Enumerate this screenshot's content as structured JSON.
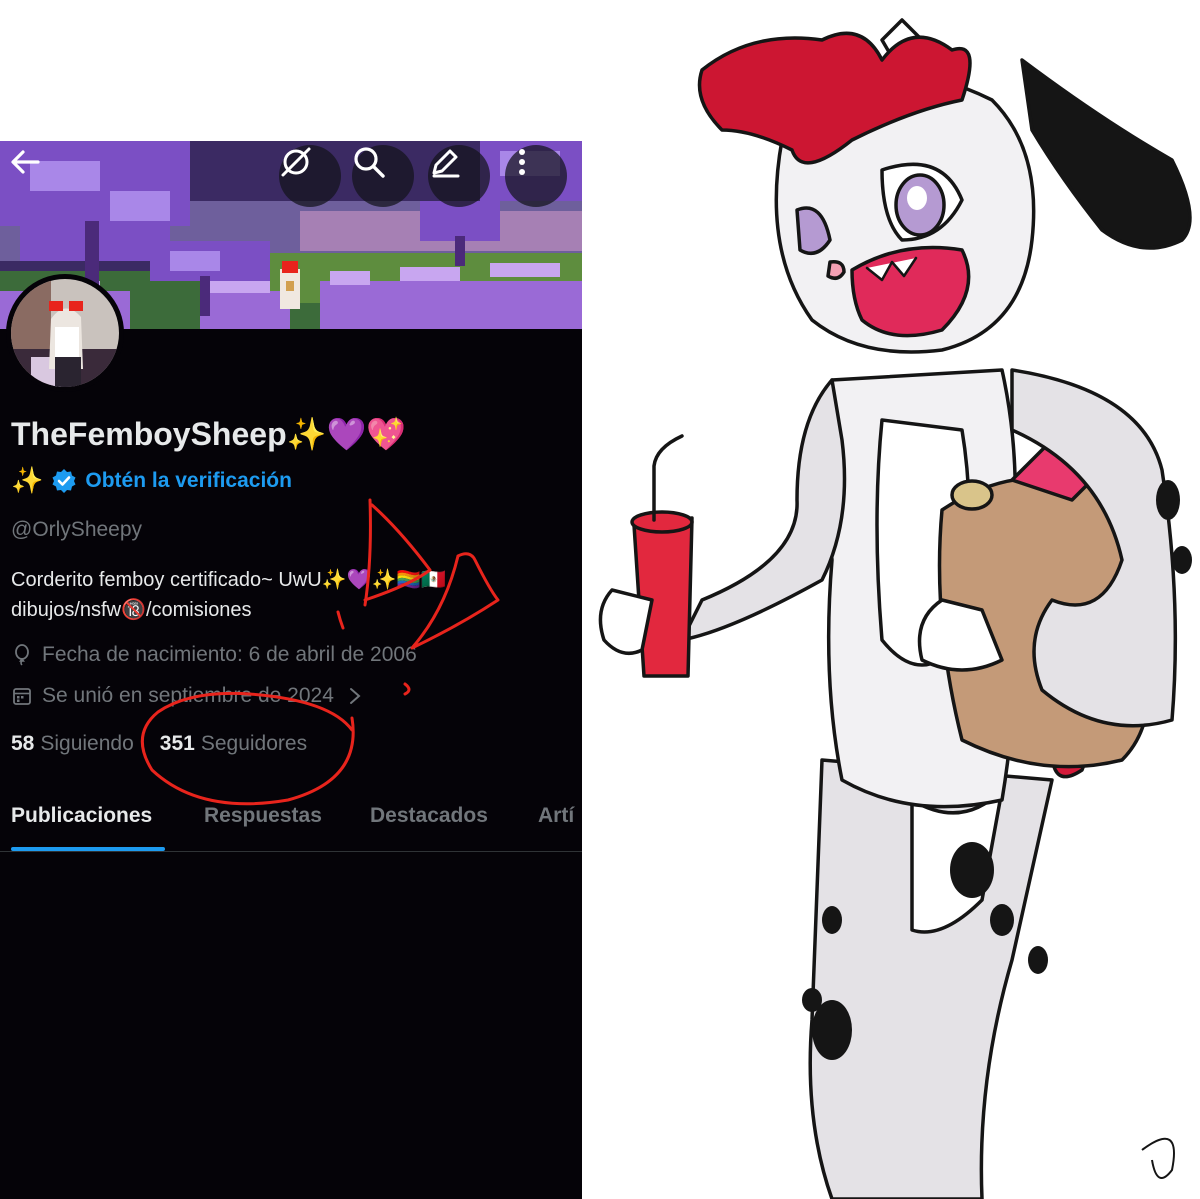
{
  "profile": {
    "display_name": "TheFemboySheep✨💜💖",
    "badge_prefix": "✨",
    "verify_label": "Obtén la verificación",
    "handle": "@OrlySheepy",
    "bio_line1": "Corderito femboy certificado~ UwU✨💜✨🏳️‍🌈🇲🇽",
    "bio_line2": "dibujos/nsfw🔞/comisiones",
    "birth": "Fecha de nacimiento: 6 de abril de 2006",
    "joined": "Se unió en septiembre de 2024",
    "following_count": "58",
    "following_label": "Siguiendo",
    "followers_count": "351",
    "followers_label": "Seguidores"
  },
  "toolbar": {
    "back": "back-arrow-icon",
    "grok": "grok-slash-icon",
    "search": "search-icon",
    "edit": "edit-pencil-icon",
    "more": "more-vertical-icon"
  },
  "tabs": [
    {
      "label": "Publicaciones",
      "active": true
    },
    {
      "label": "Respuestas",
      "active": false
    },
    {
      "label": "Destacados",
      "active": false
    },
    {
      "label": "Artí",
      "active": false
    }
  ],
  "colors": {
    "accent": "#1d9bf0",
    "background": "#050308",
    "text_primary": "#e7e9ea",
    "text_secondary": "#71767b",
    "scribble": "#e8241c"
  }
}
